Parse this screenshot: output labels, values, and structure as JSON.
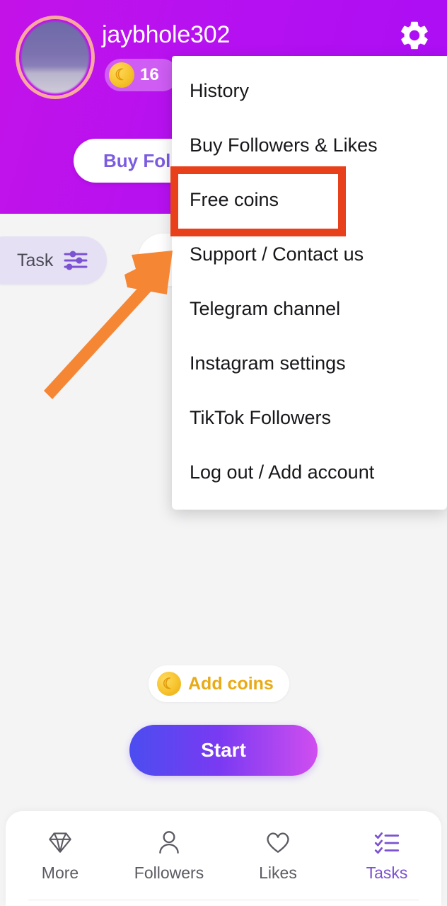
{
  "header": {
    "username": "jaybhole302",
    "coin_count": "16",
    "coin_icon": "coin-icon",
    "gear_icon": "gear-icon",
    "avatar_icon": "avatar",
    "buy_followers_label": "Buy Followers",
    "bg_color": "#b711f0"
  },
  "task_bar": {
    "chip_label": "Task",
    "filter_icon": "sliders-icon"
  },
  "menu": {
    "items": [
      {
        "label": "History"
      },
      {
        "label": "Buy Followers & Likes"
      },
      {
        "label": "Free coins"
      },
      {
        "label": "Support / Contact us"
      },
      {
        "label": "Telegram channel"
      },
      {
        "label": "Instagram settings"
      },
      {
        "label": "TikTok Followers"
      },
      {
        "label": "Log out / Add account"
      }
    ]
  },
  "annotations": {
    "highlight_box_color": "#e8401a",
    "highlight_target": "Free coins",
    "arrow_color": "#f58634",
    "arrow_name": "pointer-arrow"
  },
  "main": {
    "add_coins_label": "Add coins",
    "add_coins_icon": "coin-icon",
    "start_label": "Start"
  },
  "bottom_nav": {
    "active": "Tasks",
    "accent_color": "#7b52d1",
    "items": [
      {
        "label": "More",
        "icon": "diamond-icon"
      },
      {
        "label": "Followers",
        "icon": "person-icon"
      },
      {
        "label": "Likes",
        "icon": "heart-icon"
      },
      {
        "label": "Tasks",
        "icon": "checklist-icon"
      }
    ]
  }
}
